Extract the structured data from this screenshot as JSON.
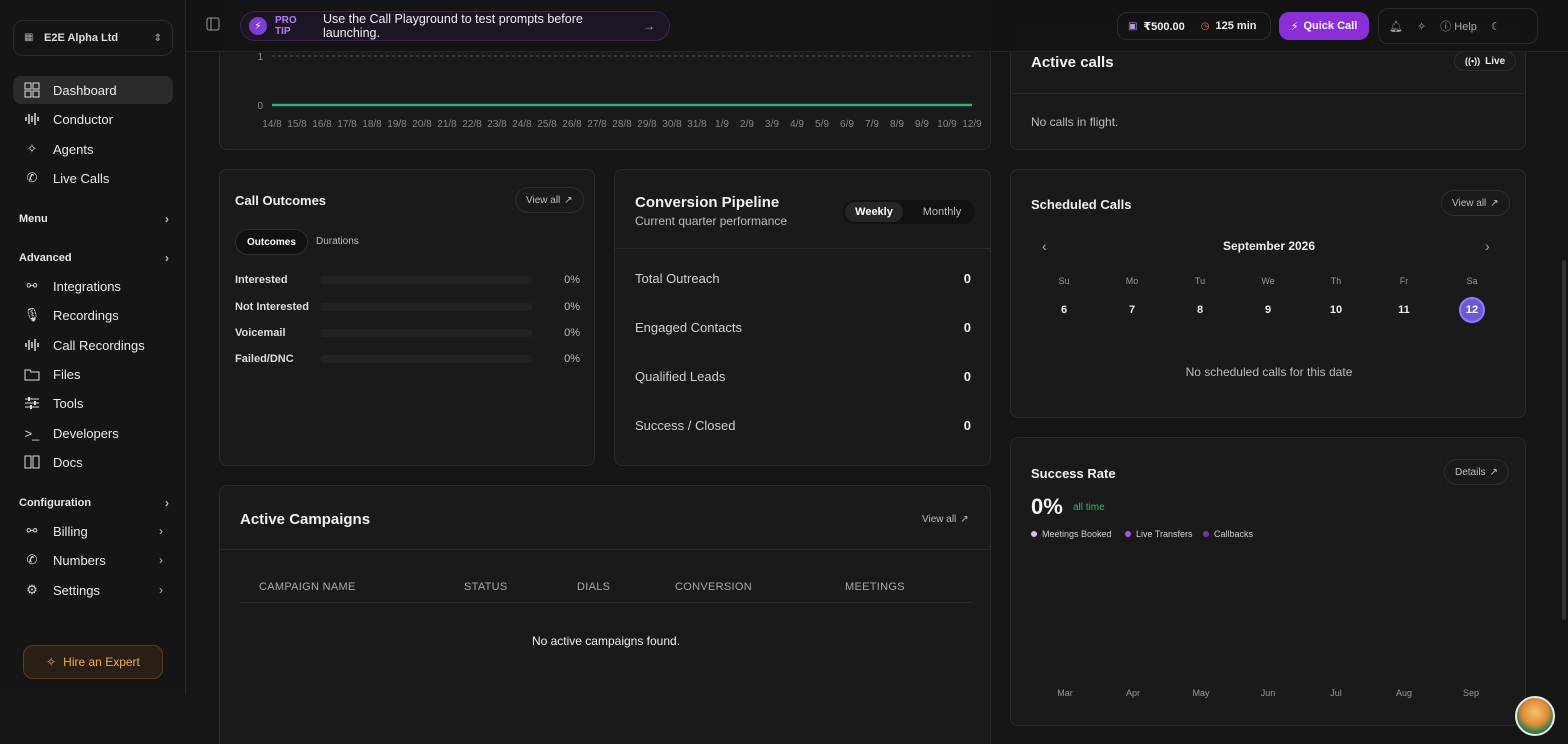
{
  "sidebar": {
    "org": "E2E Alpha Ltd",
    "items": [
      {
        "label": "Dashboard",
        "icon": "dashboard-icon"
      },
      {
        "label": "Conductor",
        "icon": "waveform-icon"
      },
      {
        "label": "Agents",
        "icon": "sparkles-icon"
      },
      {
        "label": "Live Calls",
        "icon": "phone-icon"
      }
    ],
    "menu_label": "Menu",
    "advanced_label": "Advanced",
    "advanced_items": [
      {
        "label": "Integrations",
        "icon": "webhook-icon"
      },
      {
        "label": "Recordings",
        "icon": "microphone-icon"
      },
      {
        "label": "Call Recordings",
        "icon": "waveform-icon"
      },
      {
        "label": "Files",
        "icon": "folder-icon"
      },
      {
        "label": "Tools",
        "icon": "sliders-icon"
      },
      {
        "label": "Developers",
        "icon": "terminal-icon"
      },
      {
        "label": "Docs",
        "icon": "book-icon"
      }
    ],
    "configuration_label": "Configuration",
    "config_items": [
      {
        "label": "Billing",
        "icon": "webhook-icon"
      },
      {
        "label": "Numbers",
        "icon": "phone-icon"
      },
      {
        "label": "Settings",
        "icon": "gear-icon"
      }
    ],
    "hire": "Hire an Expert"
  },
  "topbar": {
    "protip_label": "PRO TIP",
    "protip_text": "Use the Call Playground to test prompts before launching.",
    "balance": "₹500.00",
    "minutes": "125 min",
    "quick_call": "Quick Call",
    "help": "Help"
  },
  "chart": {
    "ytick_1": "1",
    "ytick_0": "0",
    "accent": "#2bb673"
  },
  "chart_data": {
    "type": "area",
    "x": [
      "14/8",
      "15/8",
      "16/8",
      "17/8",
      "18/8",
      "19/8",
      "20/8",
      "21/8",
      "22/8",
      "23/8",
      "24/8",
      "25/8",
      "26/8",
      "27/8",
      "28/8",
      "29/8",
      "30/8",
      "31/8",
      "1/9",
      "2/9",
      "3/9",
      "4/9",
      "5/9",
      "6/9",
      "7/9",
      "8/9",
      "9/9",
      "10/9",
      "12/9"
    ],
    "values": [
      0,
      0,
      0,
      0,
      0,
      0,
      0,
      0,
      0,
      0,
      0,
      0,
      0,
      0,
      0,
      0,
      0,
      0,
      0,
      0,
      0,
      0,
      0,
      0,
      0,
      0,
      0,
      0,
      0
    ],
    "ylim": [
      0,
      1
    ],
    "title": "",
    "xlabel": "",
    "ylabel": ""
  },
  "active_calls": {
    "title": "Active calls",
    "badge": "Live",
    "empty": "No calls in flight."
  },
  "outcomes": {
    "title": "Call Outcomes",
    "view_all": "View all",
    "tabs": [
      "Outcomes",
      "Durations"
    ],
    "rows": [
      {
        "label": "Interested",
        "pct": "0%"
      },
      {
        "label": "Not Interested",
        "pct": "0%"
      },
      {
        "label": "Voicemail",
        "pct": "0%"
      },
      {
        "label": "Failed/DNC",
        "pct": "0%"
      }
    ]
  },
  "pipeline": {
    "title": "Conversion Pipeline",
    "subtitle": "Current quarter performance",
    "tabs": [
      "Weekly",
      "Monthly"
    ],
    "rows": [
      {
        "label": "Total Outreach",
        "value": "0"
      },
      {
        "label": "Engaged Contacts",
        "value": "0"
      },
      {
        "label": "Qualified Leads",
        "value": "0"
      },
      {
        "label": "Success / Closed",
        "value": "0"
      }
    ]
  },
  "scheduled": {
    "title": "Scheduled Calls",
    "view_all": "View all",
    "month": "September 2026",
    "dow": [
      "Su",
      "Mo",
      "Tu",
      "We",
      "Th",
      "Fr",
      "Sa"
    ],
    "days": [
      "6",
      "7",
      "8",
      "9",
      "10",
      "11",
      "12"
    ],
    "empty": "No scheduled calls for this date"
  },
  "campaigns": {
    "title": "Active Campaigns",
    "view_all": "View all",
    "columns": [
      "CAMPAIGN NAME",
      "STATUS",
      "DIALS",
      "CONVERSION",
      "MEETINGS"
    ],
    "empty": "No active campaigns found."
  },
  "success": {
    "title": "Success Rate",
    "details": "Details",
    "value": "0%",
    "period": "all time",
    "legend": [
      {
        "label": "Meetings Booked",
        "color": "#d9b8f5"
      },
      {
        "label": "Live Transfers",
        "color": "#b24be0"
      },
      {
        "label": "Callbacks",
        "color": "#7a2fb0"
      }
    ],
    "months": [
      "Mar",
      "Apr",
      "May",
      "Jun",
      "Jul",
      "Aug",
      "Sep"
    ]
  }
}
